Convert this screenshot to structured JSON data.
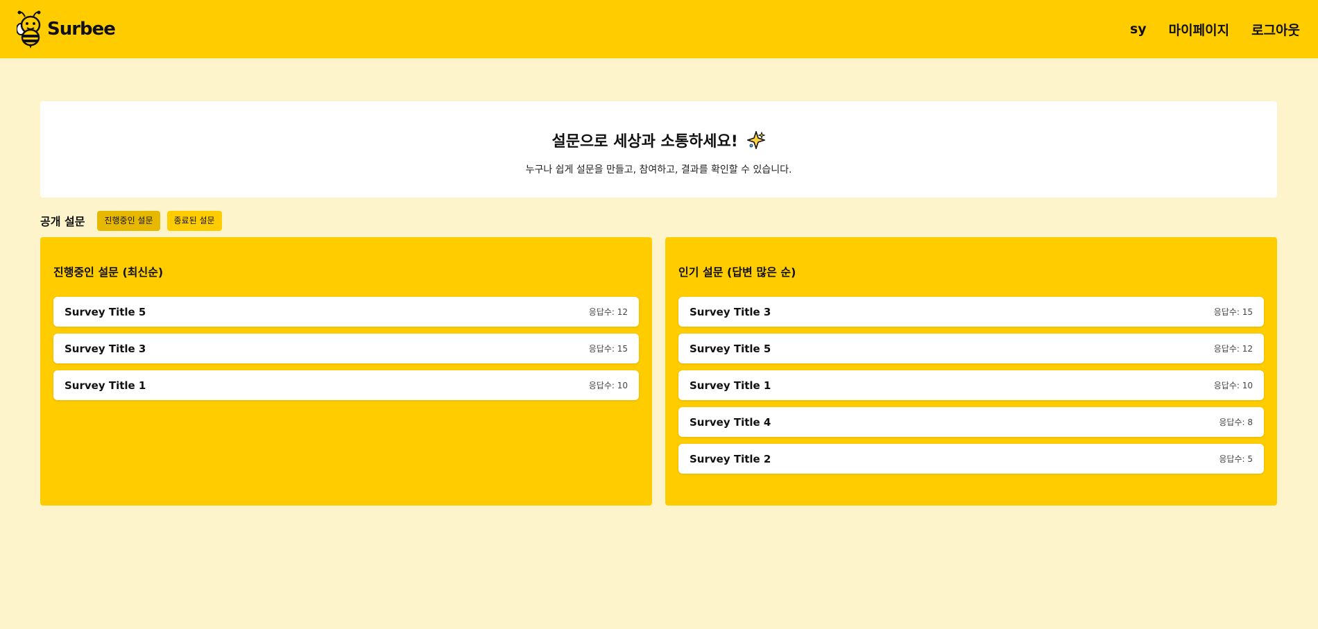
{
  "header": {
    "brand": "Surbee",
    "nav": [
      "sy",
      "마이페이지",
      "로그아웃"
    ]
  },
  "hero": {
    "title": "설문으로 세상과 소통하세요!",
    "subtitle": "누구나 쉽게 설문을 만들고, 참여하고, 결과를 확인할 수 있습니다.",
    "icon": "sparkle-icon"
  },
  "section": {
    "title": "공개 설문",
    "filters": [
      "진행중인 설문",
      "종료된 설문"
    ],
    "active_filter": "진행중인 설문"
  },
  "panels": {
    "recent": {
      "title": "진행중인 설문 (최신순)",
      "items": [
        {
          "title": "Survey Title 5",
          "count": "응답수: 12"
        },
        {
          "title": "Survey Title 3",
          "count": "응답수: 15"
        },
        {
          "title": "Survey Title 1",
          "count": "응답수: 10"
        }
      ]
    },
    "popular": {
      "title": "인기 설문 (답변 많은 순)",
      "items": [
        {
          "title": "Survey Title 3",
          "count": "응답수: 15"
        },
        {
          "title": "Survey Title 5",
          "count": "응답수: 12"
        },
        {
          "title": "Survey Title 1",
          "count": "응답수: 10"
        },
        {
          "title": "Survey Title 4",
          "count": "응답수: 8"
        },
        {
          "title": "Survey Title 2",
          "count": "응답수: 5"
        }
      ]
    }
  },
  "colors": {
    "brand_yellow": "#ffcc00",
    "page_bg": "#fdf4cb",
    "active_pill": "#e6b800"
  }
}
